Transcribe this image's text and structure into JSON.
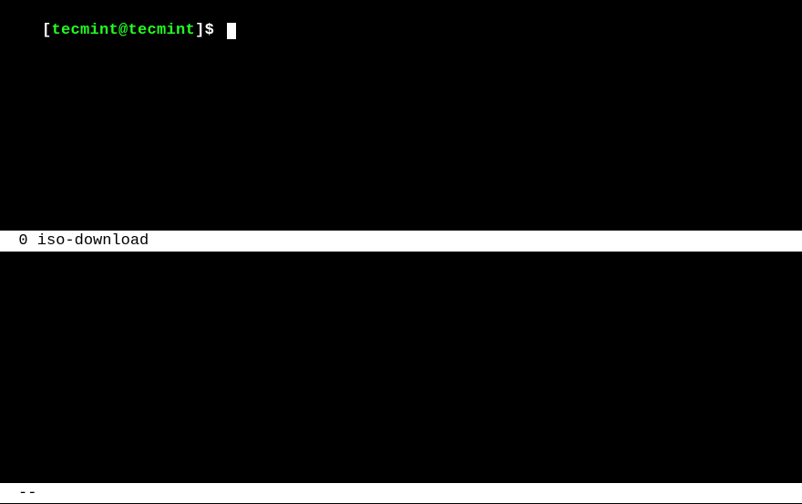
{
  "prompt": {
    "bracket_open": "[",
    "user_host": "tecmint@tecmint",
    "bracket_close": "]",
    "symbol": "$ "
  },
  "status_bar": {
    "text": "  0 iso-download"
  },
  "footer_bar": {
    "text": "--"
  }
}
